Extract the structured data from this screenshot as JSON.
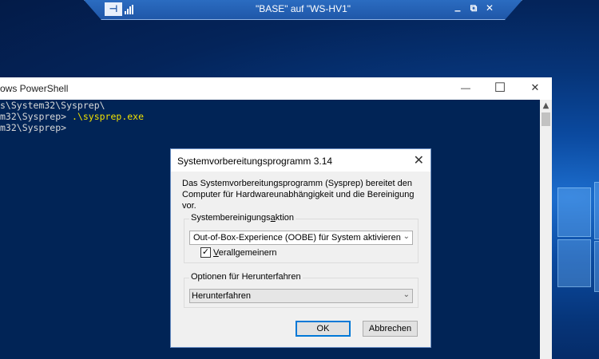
{
  "rdp_bar": {
    "title": "\"BASE\" auf \"WS-HV1\"",
    "pin_icon": "pin-icon",
    "signal_icon": "signal-strength-icon",
    "minimize": "_",
    "restore": "⧉",
    "close": "✕"
  },
  "powershell": {
    "title": "ows PowerShell",
    "controls": {
      "minimize": "—",
      "maximize": "☐",
      "close": "✕"
    },
    "lines": [
      "s\\System32\\Sysprep\\",
      "m32\\Sysprep> ",
      "m32\\Sysprep>"
    ],
    "command": ".\\sysprep.exe"
  },
  "dialog": {
    "title": "Systemvorbereitungsprogramm 3.14",
    "close": "✕",
    "description": "Das Systemvorbereitungsprogramm (Sysprep) bereitet den Computer für Hardwareunabhängigkeit und die Bereinigung vor.",
    "cleanup_group": {
      "label": "Systembereinigungsaktion",
      "selected": "Out-of-Box-Experience (OOBE) für System aktivieren",
      "generalize_label": "Verallgemeinern",
      "generalize_checked": true
    },
    "shutdown_group": {
      "label": "Optionen für Herunterfahren",
      "selected": "Herunterfahren"
    },
    "ok_label": "OK",
    "cancel_label": "Abbrechen"
  },
  "colors": {
    "console_bg": "#012456",
    "command_yellow": "#f0e000",
    "accent": "#0078d7"
  }
}
